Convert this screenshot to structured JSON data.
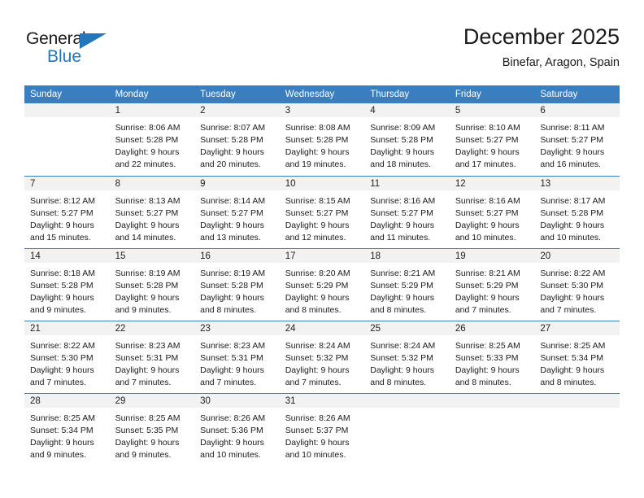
{
  "brand": {
    "name_top": "General",
    "name_bottom": "Blue"
  },
  "header": {
    "title": "December 2025",
    "subtitle": "Binefar, Aragon, Spain"
  },
  "colors": {
    "header_blue": "#3a7ebf",
    "brand_blue": "#2576b9",
    "daynum_band": "#f2f2f2"
  },
  "weekdays": [
    "Sunday",
    "Monday",
    "Tuesday",
    "Wednesday",
    "Thursday",
    "Friday",
    "Saturday"
  ],
  "weeks": [
    [
      {
        "day": "",
        "line1": "",
        "line2": "",
        "line3": "",
        "line4": ""
      },
      {
        "day": "1",
        "line1": "Sunrise: 8:06 AM",
        "line2": "Sunset: 5:28 PM",
        "line3": "Daylight: 9 hours",
        "line4": "and 22 minutes."
      },
      {
        "day": "2",
        "line1": "Sunrise: 8:07 AM",
        "line2": "Sunset: 5:28 PM",
        "line3": "Daylight: 9 hours",
        "line4": "and 20 minutes."
      },
      {
        "day": "3",
        "line1": "Sunrise: 8:08 AM",
        "line2": "Sunset: 5:28 PM",
        "line3": "Daylight: 9 hours",
        "line4": "and 19 minutes."
      },
      {
        "day": "4",
        "line1": "Sunrise: 8:09 AM",
        "line2": "Sunset: 5:28 PM",
        "line3": "Daylight: 9 hours",
        "line4": "and 18 minutes."
      },
      {
        "day": "5",
        "line1": "Sunrise: 8:10 AM",
        "line2": "Sunset: 5:27 PM",
        "line3": "Daylight: 9 hours",
        "line4": "and 17 minutes."
      },
      {
        "day": "6",
        "line1": "Sunrise: 8:11 AM",
        "line2": "Sunset: 5:27 PM",
        "line3": "Daylight: 9 hours",
        "line4": "and 16 minutes."
      }
    ],
    [
      {
        "day": "7",
        "line1": "Sunrise: 8:12 AM",
        "line2": "Sunset: 5:27 PM",
        "line3": "Daylight: 9 hours",
        "line4": "and 15 minutes."
      },
      {
        "day": "8",
        "line1": "Sunrise: 8:13 AM",
        "line2": "Sunset: 5:27 PM",
        "line3": "Daylight: 9 hours",
        "line4": "and 14 minutes."
      },
      {
        "day": "9",
        "line1": "Sunrise: 8:14 AM",
        "line2": "Sunset: 5:27 PM",
        "line3": "Daylight: 9 hours",
        "line4": "and 13 minutes."
      },
      {
        "day": "10",
        "line1": "Sunrise: 8:15 AM",
        "line2": "Sunset: 5:27 PM",
        "line3": "Daylight: 9 hours",
        "line4": "and 12 minutes."
      },
      {
        "day": "11",
        "line1": "Sunrise: 8:16 AM",
        "line2": "Sunset: 5:27 PM",
        "line3": "Daylight: 9 hours",
        "line4": "and 11 minutes."
      },
      {
        "day": "12",
        "line1": "Sunrise: 8:16 AM",
        "line2": "Sunset: 5:27 PM",
        "line3": "Daylight: 9 hours",
        "line4": "and 10 minutes."
      },
      {
        "day": "13",
        "line1": "Sunrise: 8:17 AM",
        "line2": "Sunset: 5:28 PM",
        "line3": "Daylight: 9 hours",
        "line4": "and 10 minutes."
      }
    ],
    [
      {
        "day": "14",
        "line1": "Sunrise: 8:18 AM",
        "line2": "Sunset: 5:28 PM",
        "line3": "Daylight: 9 hours",
        "line4": "and 9 minutes."
      },
      {
        "day": "15",
        "line1": "Sunrise: 8:19 AM",
        "line2": "Sunset: 5:28 PM",
        "line3": "Daylight: 9 hours",
        "line4": "and 9 minutes."
      },
      {
        "day": "16",
        "line1": "Sunrise: 8:19 AM",
        "line2": "Sunset: 5:28 PM",
        "line3": "Daylight: 9 hours",
        "line4": "and 8 minutes."
      },
      {
        "day": "17",
        "line1": "Sunrise: 8:20 AM",
        "line2": "Sunset: 5:29 PM",
        "line3": "Daylight: 9 hours",
        "line4": "and 8 minutes."
      },
      {
        "day": "18",
        "line1": "Sunrise: 8:21 AM",
        "line2": "Sunset: 5:29 PM",
        "line3": "Daylight: 9 hours",
        "line4": "and 8 minutes."
      },
      {
        "day": "19",
        "line1": "Sunrise: 8:21 AM",
        "line2": "Sunset: 5:29 PM",
        "line3": "Daylight: 9 hours",
        "line4": "and 7 minutes."
      },
      {
        "day": "20",
        "line1": "Sunrise: 8:22 AM",
        "line2": "Sunset: 5:30 PM",
        "line3": "Daylight: 9 hours",
        "line4": "and 7 minutes."
      }
    ],
    [
      {
        "day": "21",
        "line1": "Sunrise: 8:22 AM",
        "line2": "Sunset: 5:30 PM",
        "line3": "Daylight: 9 hours",
        "line4": "and 7 minutes."
      },
      {
        "day": "22",
        "line1": "Sunrise: 8:23 AM",
        "line2": "Sunset: 5:31 PM",
        "line3": "Daylight: 9 hours",
        "line4": "and 7 minutes."
      },
      {
        "day": "23",
        "line1": "Sunrise: 8:23 AM",
        "line2": "Sunset: 5:31 PM",
        "line3": "Daylight: 9 hours",
        "line4": "and 7 minutes."
      },
      {
        "day": "24",
        "line1": "Sunrise: 8:24 AM",
        "line2": "Sunset: 5:32 PM",
        "line3": "Daylight: 9 hours",
        "line4": "and 7 minutes."
      },
      {
        "day": "25",
        "line1": "Sunrise: 8:24 AM",
        "line2": "Sunset: 5:32 PM",
        "line3": "Daylight: 9 hours",
        "line4": "and 8 minutes."
      },
      {
        "day": "26",
        "line1": "Sunrise: 8:25 AM",
        "line2": "Sunset: 5:33 PM",
        "line3": "Daylight: 9 hours",
        "line4": "and 8 minutes."
      },
      {
        "day": "27",
        "line1": "Sunrise: 8:25 AM",
        "line2": "Sunset: 5:34 PM",
        "line3": "Daylight: 9 hours",
        "line4": "and 8 minutes."
      }
    ],
    [
      {
        "day": "28",
        "line1": "Sunrise: 8:25 AM",
        "line2": "Sunset: 5:34 PM",
        "line3": "Daylight: 9 hours",
        "line4": "and 9 minutes."
      },
      {
        "day": "29",
        "line1": "Sunrise: 8:25 AM",
        "line2": "Sunset: 5:35 PM",
        "line3": "Daylight: 9 hours",
        "line4": "and 9 minutes."
      },
      {
        "day": "30",
        "line1": "Sunrise: 8:26 AM",
        "line2": "Sunset: 5:36 PM",
        "line3": "Daylight: 9 hours",
        "line4": "and 10 minutes."
      },
      {
        "day": "31",
        "line1": "Sunrise: 8:26 AM",
        "line2": "Sunset: 5:37 PM",
        "line3": "Daylight: 9 hours",
        "line4": "and 10 minutes."
      },
      {
        "day": "",
        "line1": "",
        "line2": "",
        "line3": "",
        "line4": ""
      },
      {
        "day": "",
        "line1": "",
        "line2": "",
        "line3": "",
        "line4": ""
      },
      {
        "day": "",
        "line1": "",
        "line2": "",
        "line3": "",
        "line4": ""
      }
    ]
  ]
}
